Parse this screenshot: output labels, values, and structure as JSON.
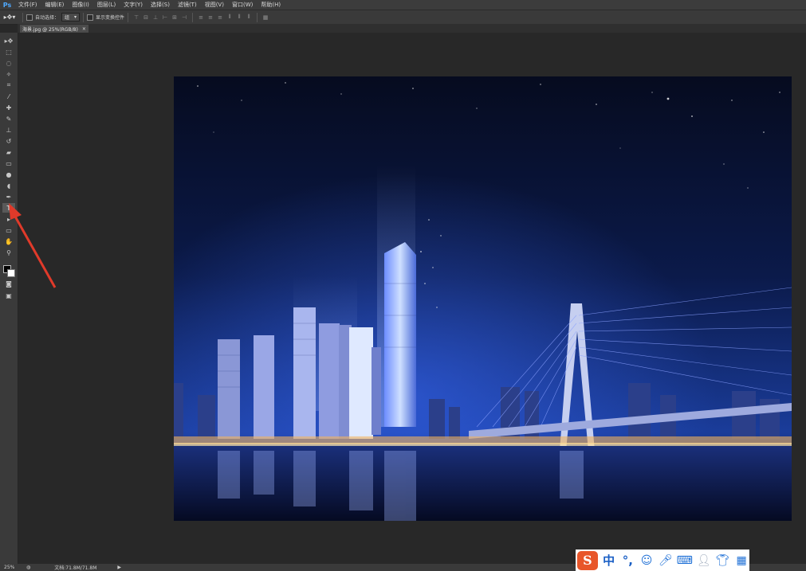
{
  "app": {
    "logo": "Ps"
  },
  "menu": [
    "文件(F)",
    "编辑(E)",
    "图像(I)",
    "图层(L)",
    "文字(Y)",
    "选择(S)",
    "滤镜(T)",
    "视图(V)",
    "窗口(W)",
    "帮助(H)"
  ],
  "options": {
    "auto_select_label": "自动选择：",
    "auto_select_value": "组",
    "show_transform_label": "显示变换控件"
  },
  "document": {
    "tab_title": "海景.jpg @ 25%(RGB/8)",
    "close_glyph": "×"
  },
  "tools": [
    "move-tool",
    "marquee-tool",
    "lasso-tool",
    "quick-select-tool",
    "crop-tool",
    "eyedropper-tool",
    "healing-brush-tool",
    "brush-tool",
    "clone-stamp-tool",
    "history-brush-tool",
    "eraser-tool",
    "gradient-tool",
    "blur-tool",
    "dodge-tool",
    "pen-tool",
    "type-tool",
    "path-select-tool",
    "shape-tool",
    "hand-tool",
    "zoom-tool"
  ],
  "status": {
    "zoom": "25%",
    "doc_size": "文档:71.8M/71.8M"
  },
  "ime": {
    "logo": "S",
    "lang": "中",
    "punct": "°,",
    "icons": [
      "emoji-icon",
      "mic-icon",
      "keyboard-icon",
      "user-icon",
      "shirt-icon",
      "grid-icon"
    ]
  },
  "colors": {
    "accent": "#4fa9ff",
    "arrow": "#e03a2a",
    "ime_brand": "#e8562a"
  }
}
